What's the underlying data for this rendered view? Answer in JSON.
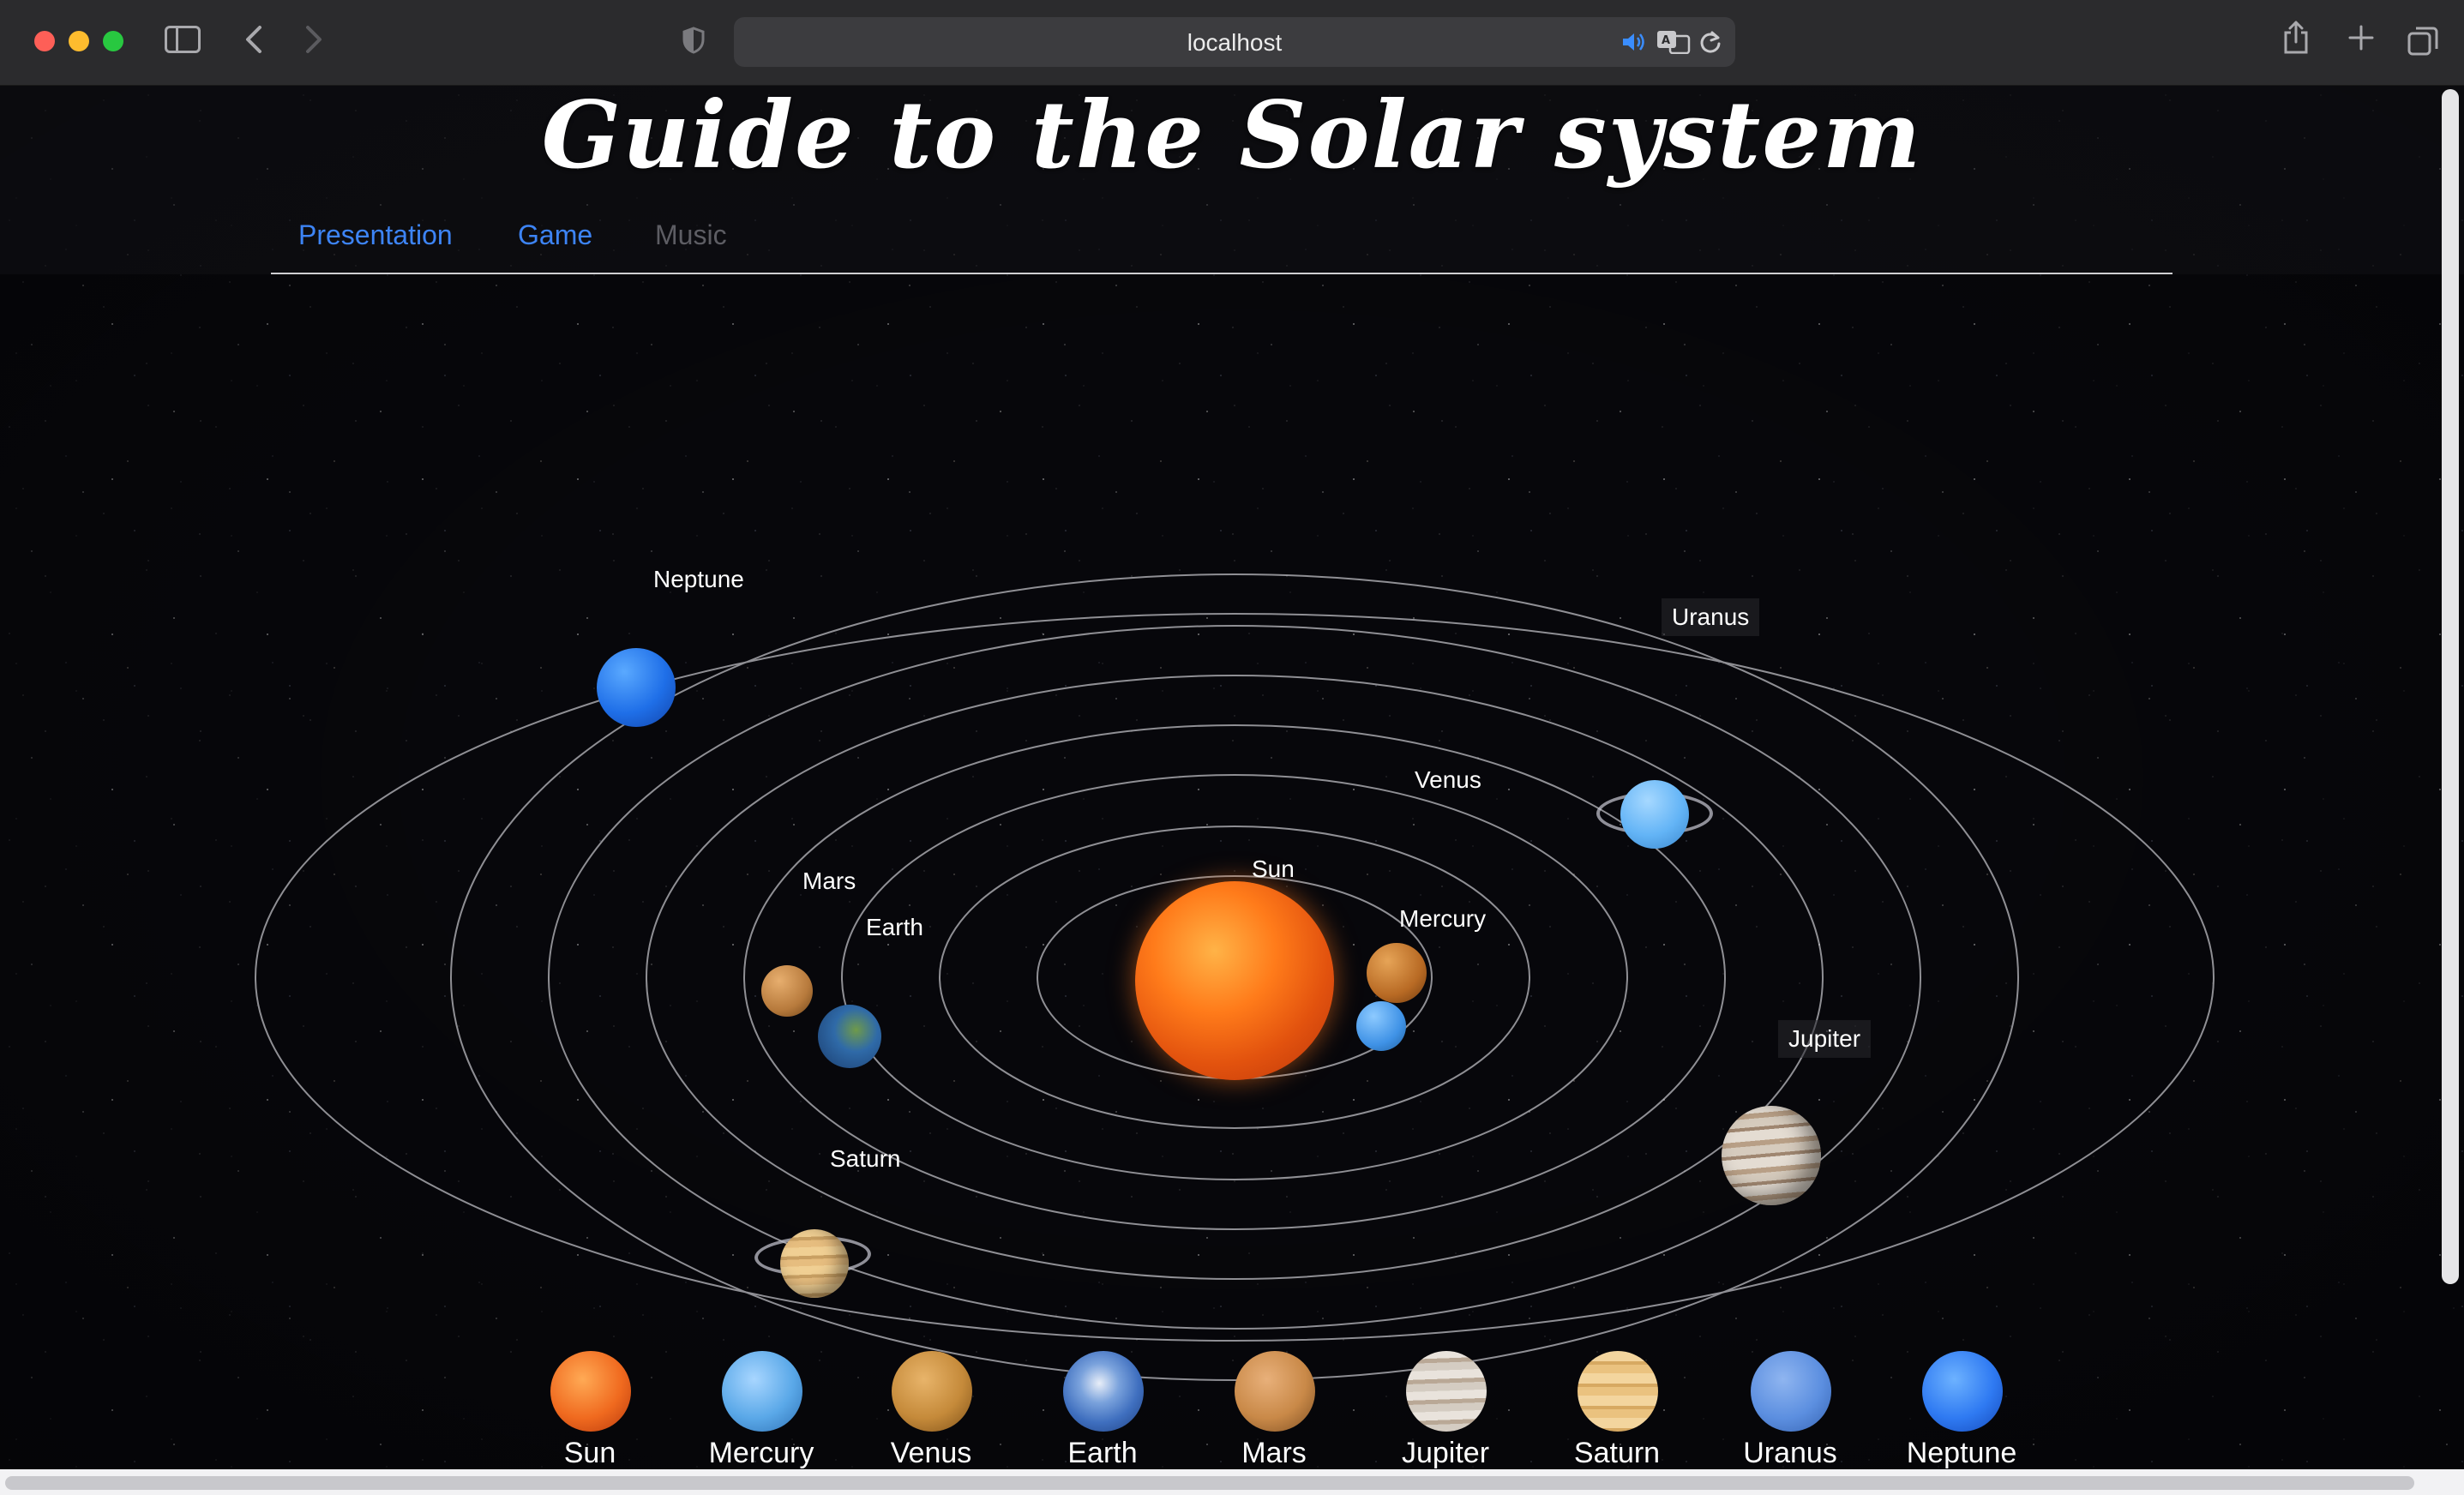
{
  "browser": {
    "url": "localhost",
    "icons": [
      "sidebar-icon",
      "back-icon",
      "forward-icon",
      "shield-icon",
      "speaker-icon",
      "translate-icon",
      "reload-icon",
      "share-icon",
      "new-tab-icon",
      "tabs-overview-icon"
    ]
  },
  "site": {
    "title": "Guide to the Solar system",
    "nav": [
      {
        "label": "Presentation",
        "active": true
      },
      {
        "label": "Game",
        "active": true
      },
      {
        "label": "Music",
        "active": false
      }
    ]
  },
  "orbit_labels": {
    "neptune": "Neptune",
    "uranus": "Uranus",
    "mars": "Mars",
    "earth": "Earth",
    "venus": "Venus",
    "sun": "Sun",
    "mercury": "Mercury",
    "jupiter": "Jupiter",
    "saturn": "Saturn"
  },
  "planet_picker": [
    {
      "label": "Sun",
      "color": "#f06a1f"
    },
    {
      "label": "Mercury",
      "color": "#5aa8e8"
    },
    {
      "label": "Venus",
      "color": "#c58a3a"
    },
    {
      "label": "Earth",
      "color": "#3f6fbf"
    },
    {
      "label": "Mars",
      "color": "#c98948"
    },
    {
      "label": "Jupiter",
      "color": "#cfc7bf"
    },
    {
      "label": "Saturn",
      "color": "#e0b777"
    },
    {
      "label": "Uranus",
      "color": "#5c8fe0"
    },
    {
      "label": "Neptune",
      "color": "#2f7af2"
    }
  ],
  "colors": {
    "nav_link": "#3d84f5",
    "nav_link_muted": "#5d5d63",
    "space": "#07070b",
    "orbit": "#d8d8de"
  }
}
